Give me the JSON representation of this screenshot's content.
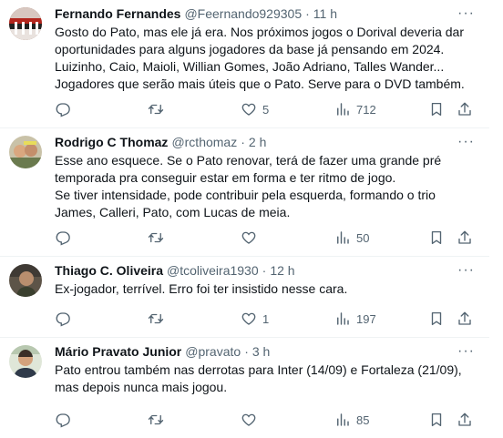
{
  "tweets": [
    {
      "name": "Fernando Fernandes",
      "handle": "@Feernando929305",
      "time": "11 h",
      "lines": [
        "Gosto do Pato, mas ele já era. Nos próximos jogos o Dorival deveria dar",
        "oportunidades para alguns jogadores da base já pensando em 2024.",
        "Luizinho, Caio, Maioli, Willian Gomes, João Adriano, Talles Wander...",
        "Jogadores que serão mais úteis que o Pato. Serve para o DVD também."
      ],
      "likes": "5",
      "views": "712"
    },
    {
      "name": "Rodrigo C Thomaz",
      "handle": "@rcthomaz",
      "time": "2 h",
      "lines": [
        "Esse ano esquece. Se o Pato renovar, terá de fazer uma grande pré",
        "temporada pra conseguir estar em forma e ter ritmo de jogo.",
        "Se tiver intensidade, pode contribuir pela esquerda, formando o trio",
        "James, Calleri, Pato, com Lucas de meia."
      ],
      "likes": "",
      "views": "50"
    },
    {
      "name": "Thiago C. Oliveira",
      "handle": "@tcoliveira1930",
      "time": "12 h",
      "lines": [
        "Ex-jogador, terrível. Erro foi ter insistido nesse cara."
      ],
      "likes": "1",
      "views": "197"
    },
    {
      "name": "Mário Pravato Junior",
      "handle": "@pravato",
      "time": "3 h",
      "lines": [
        "Pato entrou também nas derrotas para Inter (14/09) e Fortaleza (21/09),",
        "mas depois nunca mais jogou."
      ],
      "likes": "",
      "views": "85"
    }
  ],
  "separator": "·",
  "more_glyph": "···",
  "icons": {
    "reply": "reply-icon",
    "retweet": "retweet-icon",
    "like": "heart-icon",
    "views": "views-icon",
    "bookmark": "bookmark-icon",
    "share": "share-icon"
  },
  "colors": {
    "text": "#0f1419",
    "secondary": "#536471",
    "divider": "#eff3f4"
  }
}
